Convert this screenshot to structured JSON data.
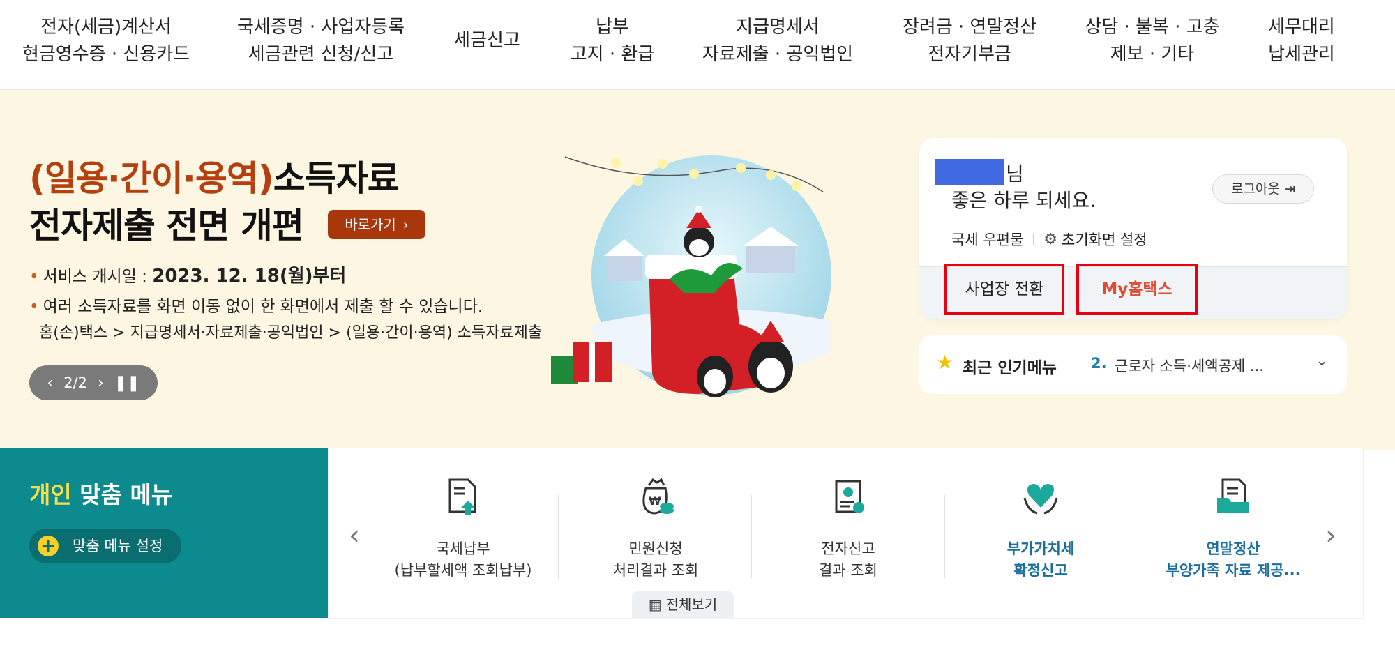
{
  "nav": [
    {
      "line1": "전자(세금)계산서",
      "line2": "현금영수증 · 신용카드"
    },
    {
      "line1": "국세증명 · 사업자등록",
      "line2": "세금관련 신청/신고"
    },
    {
      "line1": "세금신고",
      "line2": ""
    },
    {
      "line1": "납부",
      "line2": "고지 · 환급"
    },
    {
      "line1": "지급명세서",
      "line2": "자료제출 · 공익법인"
    },
    {
      "line1": "장려금 · 연말정산",
      "line2": "전자기부금"
    },
    {
      "line1": "상담 · 불복 · 고충",
      "line2": "제보 · 기타"
    },
    {
      "line1": "세무대리",
      "line2": "납세관리"
    }
  ],
  "banner": {
    "headline_accent": "(일용·간이·용역)",
    "headline_rest": "소득자료",
    "headline_line2": "전자제출 전면 개편",
    "goto_label": "바로가기",
    "bullet1_label": "서비스 개시일 :",
    "bullet1_value": "2023. 12. 18(월)부터",
    "bullet2": "여러 소득자료를 화면 이동 없이 한 화면에서 제출 할 수 있습니다.",
    "path": "홈(손)택스 > 지급명세서·자료제출·공익법인 > (일용·간이·용역) 소득자료제출",
    "pager": "2/2"
  },
  "user": {
    "name_suffix": "님",
    "greeting": "좋은 하루 되세요.",
    "logout_label": "로그아웃",
    "link1": "국세 우편물",
    "link2": "초기화면 설정",
    "switch_label": "사업장 전환",
    "my_label": "My홈택스"
  },
  "popular": {
    "title": "최근 인기메뉴",
    "rank": "2.",
    "text": "근로자 소득·세액공제 ..."
  },
  "custom": {
    "title_hl": "개인",
    "title_rest": "맞춤 메뉴",
    "setting_label": "맞춤 메뉴 설정"
  },
  "menu": [
    {
      "line1": "국세납부",
      "line2": "(납부할세액 조회납부)",
      "highlight": false
    },
    {
      "line1": "민원신청",
      "line2": "처리결과 조회",
      "highlight": false
    },
    {
      "line1": "전자신고",
      "line2": "결과 조회",
      "highlight": false
    },
    {
      "line1": "부가가치세",
      "line2": "확정신고",
      "highlight": true
    },
    {
      "line1": "연말정산",
      "line2": "부양가족 자료 제공...",
      "highlight": true
    }
  ],
  "all_view_label": "전체보기",
  "colors": {
    "banner_bg": "#fcf6e2",
    "accent_orange": "#b3400e",
    "teal": "#0d8a8d",
    "highlight_red": "#e60012",
    "link_blue": "#1a6ea0"
  }
}
